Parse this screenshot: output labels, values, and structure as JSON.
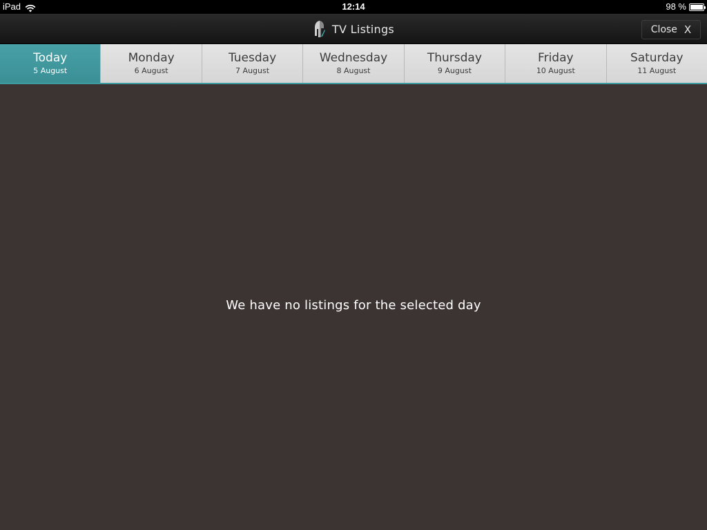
{
  "status_bar": {
    "device": "iPad",
    "time": "12:14",
    "battery_percent_label": "98 %",
    "battery_level": 0.98,
    "wifi_icon": "wifi-icon",
    "battery_icon": "battery-icon"
  },
  "header": {
    "title": "TV Listings",
    "logo_icon": "spartan-helmet-logo-icon",
    "close_label": "Close",
    "close_glyph": "X"
  },
  "days": [
    {
      "day": "Today",
      "date": "5 August",
      "active": true
    },
    {
      "day": "Monday",
      "date": "6 August",
      "active": false
    },
    {
      "day": "Tuesday",
      "date": "7 August",
      "active": false
    },
    {
      "day": "Wednesday",
      "date": "8 August",
      "active": false
    },
    {
      "day": "Thursday",
      "date": "9 August",
      "active": false
    },
    {
      "day": "Friday",
      "date": "10 August",
      "active": false
    },
    {
      "day": "Saturday",
      "date": "11 August",
      "active": false
    }
  ],
  "content": {
    "empty_message": "We have no listings for the selected day"
  },
  "colors": {
    "accent": "#3d9aa0",
    "background": "#3c3433",
    "tab_inactive": "#dcdcdc",
    "header_bg": "#1a1a1a"
  }
}
